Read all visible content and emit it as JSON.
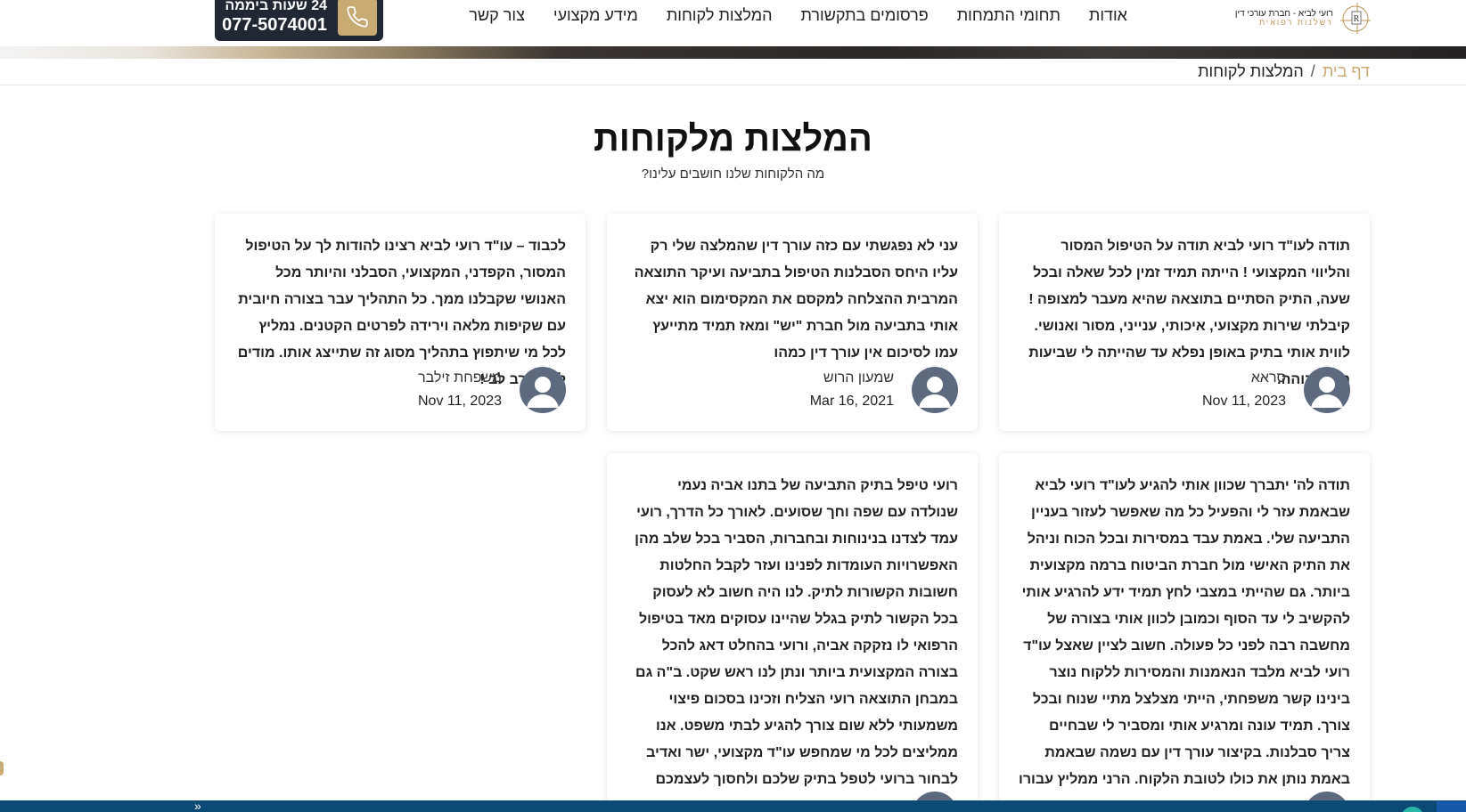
{
  "header": {
    "logo": {
      "line1": "רועי לביא - חברת עורכי דין",
      "line2": "רשלנות רפואית"
    },
    "nav": [
      {
        "label": "אודות"
      },
      {
        "label": "תחומי התמחות"
      },
      {
        "label": "פרסומים בתקשורת"
      },
      {
        "label": "המלצות לקוחות"
      },
      {
        "label": "מידע מקצועי"
      },
      {
        "label": "צור קשר"
      }
    ],
    "phone": {
      "hours": "24 שעות ביממה",
      "number": "077-5074001",
      "icon": "phone-icon"
    }
  },
  "breadcrumb": {
    "home": "דף בית",
    "separator": "/",
    "current": "המלצות לקוחות"
  },
  "page": {
    "title": "המלצות מלקוחות",
    "subtitle": "מה הלקוחות שלנו חושבים עלינו?"
  },
  "testimonials": [
    {
      "text": "תודה לעו\"ד רועי לביא תודה על הטיפול המסור והליווי המקצועי ! הייתה תמיד זמין לכל שאלה ובכל שעה, התיק הסתיים בתוצאה שהיא מעבר למצופה ! קיבלתי שירות מקצועי, איכותי, ענייני, מסור ואנושי. לווית אותי בתיק באופן נפלא עד שהייתה לי שביעות רצון גבוהה.",
      "author": "סראא",
      "date": "Nov 11, 2023"
    },
    {
      "text": "עני לא נפגשתי עם כזה עורך דין שהמלצה שלי רק עליו היחס הסבלנות הטיפול בתביעה ועיקר התוצאה המרבית ההצלחה למקסם את המקסימום הוא יצא אותי בתביעה מול חברת \"יש\" ומאז תמיד מתייעץ עמו לסיכום אין עורך דין כמהו",
      "author": "שמעון הרוש",
      "date": "Mar 16, 2021"
    },
    {
      "text": "לכבוד – עו\"ד רועי לביא רצינו להודות לך על הטיפול המסור, הקפדני, המקצועי, הסבלני והיותר מכל האנושי שקבלנו ממך. כל התהליך עבר בצורה חיובית עם שקיפות מלאה וירידה לפרטים הקטנים. נמליץ לכל מי שיתפוץ בתהליך מסוג זה שתייצג אותו. מודים לך מקרב לב !",
      "author": "משפחת זילבר",
      "date": "Nov 11, 2023"
    },
    {
      "text": "תודה לה' יתברך שכוון אותי להגיע לעו\"ד רועי לביא שבאמת עזר לי והפעיל כל מה שאפשר לעזור בעניין התביעה שלי. באמת עבד במסירות ובכל הכוח וניהל את התיק האישי מול חברת הביטוח ברמה מקצועית ביותר. גם שהייתי במצבי לחץ תמיד ידע להרגיע אותי להקשיב לי עד הסוף וכמובן לכוון אותי בצורה של מחשבה רבה לפני כל פעולה. חשוב לציין שאצל עו\"ד רועי לביא מלבד הנאמנות והמסירות ללקוח נוצר בינינו קשר משפחתי, הייתי מצלצל מתיי שנוח ובכל צורך. תמיד עונה ומרגיע אותי ומסביר לי שבחיים צריך סבלנות. בקיצור עורך דין עם נשמה שבאמת באמת נותן את כולו לטובת הלקוח. הרני ממליץ עבורו",
      "author": "",
      "date": ""
    },
    {
      "text": "רועי טיפל בתיק התביעה של בתנו אביה נעמי שנולדה עם שפה וחך שסועים. לאורך כל הדרך, רועי עמד לצדנו בנינוחות ובחברות, הסביר בכל שלב מהן האפשרויות העומדות לפנינו ועזר לקבל החלטות חשובות הקשורות לתיק. לנו היה חשוב לא לעסוק בכל הקשור לתיק בגלל שהיינו עסוקים מאד בטיפול הרפואי לו נזקקה אביה, ורועי בהחלט דאג להכל בצורה המקצועית ביותר ונתן לנו ראש שקט. ב\"ה גם במבחן התוצאה רועי הצליח וזכינו בסכום פיצוי משמעותי ללא שום צורך להגיע לבתי משפט. אנו ממליצים לכל מי שמחפש עו\"ד מקצועי, ישר ואדיב לבחור ברועי לטפל בתיק שלכם ולחסוך לעצמכם כאבי ראש מיותרים",
      "author": "",
      "date": ""
    }
  ],
  "icons": {
    "avatar": "user-avatar-icon",
    "scroll": "chevron-double-left-icon"
  },
  "colors": {
    "accent": "#c8aa73",
    "dark": "#222833",
    "footer": "#0c4a76"
  },
  "bottom_bar": {
    "chevron": "«"
  }
}
